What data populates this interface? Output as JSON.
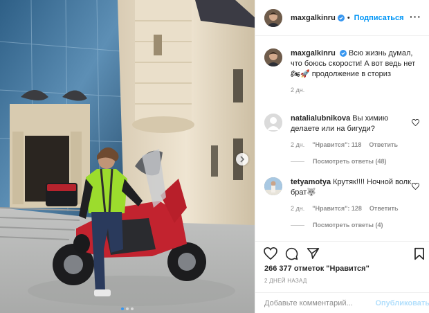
{
  "header": {
    "username": "maxgalkinru",
    "follow_label": "Подписаться",
    "separator": "•",
    "more_label": "···"
  },
  "caption": {
    "username": "maxgalkinru",
    "text": "Всю жизнь думал, что боюсь скорости! А вот ведь нет 🏍🚀 продолжение в сториз",
    "time": "2 дн."
  },
  "comments": [
    {
      "username": "natalialubnikova",
      "text": "Вы химию делаете или на бигуди?",
      "time": "2 дн.",
      "likes": "\"Нравится\": 118",
      "reply_label": "Ответить",
      "view_replies": "Посмотреть ответы (48)"
    },
    {
      "username": "tetyamotya",
      "text": "Крутяк!!!! Ночной волк, брат🐺",
      "time": "2 дн.",
      "likes": "\"Нравится\": 128",
      "reply_label": "Ответить",
      "view_replies": "Посмотреть ответы (4)"
    }
  ],
  "stats": {
    "likes": "266 377 отметок \"Нравится\"",
    "posted": "2 ДНЕЙ НАЗАД"
  },
  "composer": {
    "placeholder": "Добавьте комментарий...",
    "post_label": "Опубликовать"
  },
  "carousel": {
    "total": 3,
    "current": 1
  },
  "colors": {
    "link_blue": "#0095f6",
    "verified_blue": "#3897f0",
    "muted": "#8e8e8e"
  },
  "icons": [
    "verified-badge-icon",
    "more-options-icon",
    "heart-icon",
    "comment-icon",
    "share-icon",
    "bookmark-icon",
    "next-arrow-icon"
  ]
}
